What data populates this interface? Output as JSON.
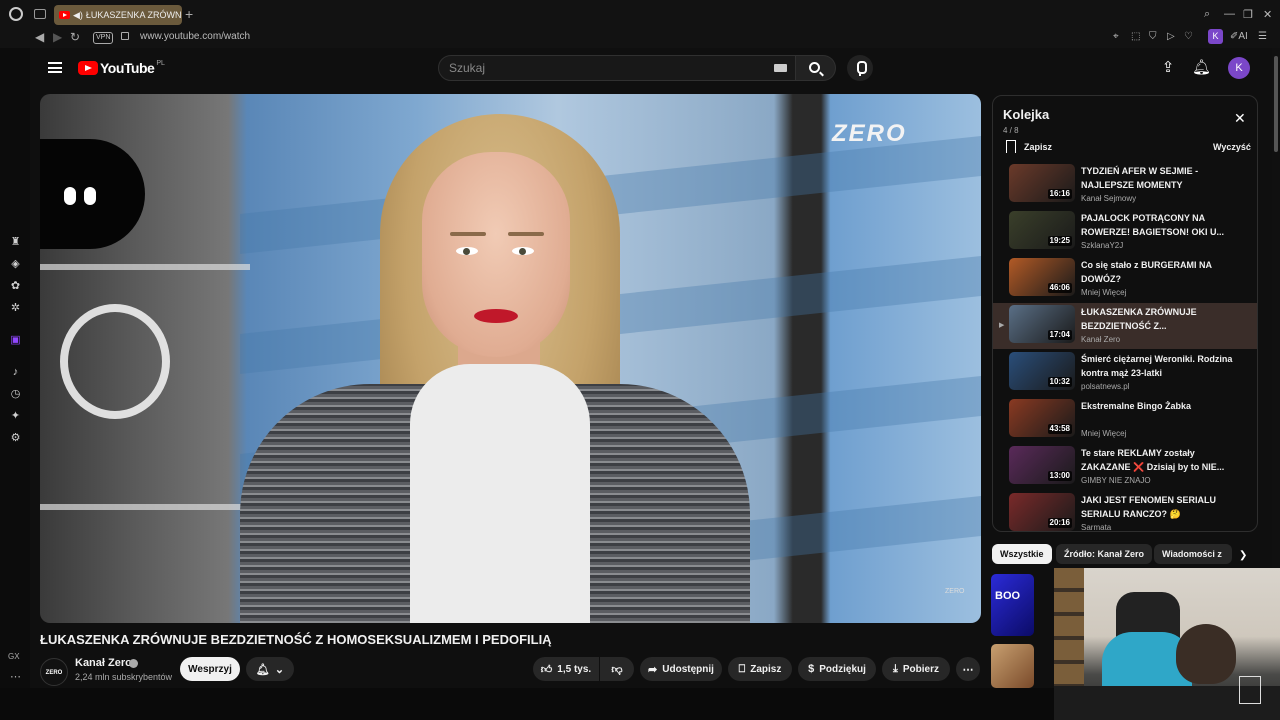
{
  "browser": {
    "tab_title": "ŁUKASZENKA ZRÓWN",
    "url": "www.youtube.com/watch",
    "vpn_label": "VPN",
    "ai_label": "AI",
    "ext_avatar": "K"
  },
  "header": {
    "logo_text": "YouTube",
    "country_code": "PL",
    "search_placeholder": "Szukaj",
    "avatar_letter": "K"
  },
  "video": {
    "overlay_logo": "ZERO",
    "watermark": "ZERO",
    "title": "ŁUKASZENKA ZRÓWNUJE BEZDZIETNOŚĆ Z HOMOSEKSUALIZMEM I PEDOFILIĄ"
  },
  "channel": {
    "avatar_text": "ZERO",
    "name": "Kanał Zero",
    "subscribers": "2,24 mln subskrybentów",
    "support_label": "Wesprzyj"
  },
  "actions": {
    "likes": "1,5 tys.",
    "share": "Udostępnij",
    "save": "Zapisz",
    "thanks": "Podziękuj",
    "download": "Pobierz"
  },
  "queue": {
    "title": "Kolejka",
    "position": "4 / 8",
    "save_label": "Zapisz",
    "clear_label": "Wyczyść",
    "items": [
      {
        "title": "TYDZIEŃ AFER W SEJMIE - NAJLEPSZE MOMENTY",
        "channel": "Kanał Sejmowy",
        "duration": "16:16",
        "color": "#6b3a2a"
      },
      {
        "title": "PAJALOCK POTRĄCONY NA ROWERZE! BAGIETSON! OKI U...",
        "channel": "SzklanaY2J",
        "duration": "19:25",
        "color": "#3a3f2a"
      },
      {
        "title": "Co się stało z BURGERAMI NA DOWÓZ?",
        "channel": "Mniej Więcej",
        "duration": "46:06",
        "color": "#b25a26"
      },
      {
        "title": "ŁUKASZENKA ZRÓWNUJE BEZDZIETNOŚĆ Z...",
        "channel": "Kanał Zero",
        "duration": "17:04",
        "color": "#5a6f86"
      },
      {
        "title": "Śmierć ciężarnej Weroniki. Rodzina kontra mąż 23-latki",
        "channel": "polsatnews.pl",
        "duration": "10:32",
        "color": "#2a4e7a"
      },
      {
        "title": "Ekstremalne Bingo Żabka",
        "channel": "Mniej Więcej",
        "duration": "43:58",
        "color": "#8a3a22"
      },
      {
        "title": "Te stare REKLAMY zostały ZAKAZANE ❌ Dzisiaj by to NIE...",
        "channel": "GIMBY NIE ZNAJO",
        "duration": "13:00",
        "color": "#5a2a5a"
      },
      {
        "title": "JAKI JEST FENOMEN SERIALU SERIALU RANCZO? 🤔",
        "channel": "Sarmata",
        "duration": "20:16",
        "color": "#7a2a2a"
      }
    ]
  },
  "chips": [
    "Wszystkie",
    "Źródło: Kanał Zero",
    "Wiadomości z"
  ],
  "recommend": {
    "thumb1_text": "BOO"
  },
  "sidebar": {
    "gx_label": "GX"
  }
}
